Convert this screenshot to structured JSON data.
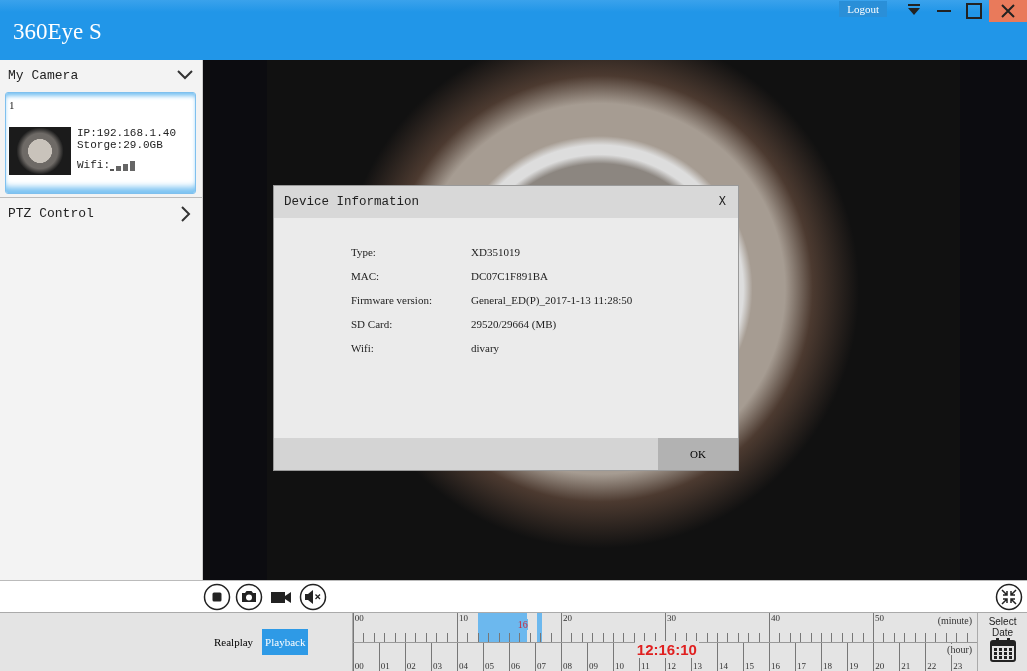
{
  "window": {
    "title": "360Eye S",
    "logout": "Logout"
  },
  "sidebar": {
    "my_camera": {
      "label": "My Camera",
      "expanded": true
    },
    "cameras": [
      {
        "name": "1",
        "ip": "IP:192.168.1.40",
        "storage": "Storge:29.0GB",
        "wifi": "Wifi:",
        "selected": true
      }
    ],
    "ptz": {
      "label": "PTZ Control",
      "expanded": false
    }
  },
  "dialog": {
    "title": "Device Information",
    "close": "X",
    "fields": [
      {
        "label": "Type:",
        "value": "XD351019"
      },
      {
        "label": "MAC:",
        "value": "DC07C1F891BA"
      },
      {
        "label": "Firmware version:",
        "value": "General_ED(P)_2017-1-13 11:28:50"
      },
      {
        "label": "SD Card:",
        "value": "29520/29664 (MB)"
      },
      {
        "label": "Wifi:",
        "value": "divary"
      }
    ],
    "ok": "OK"
  },
  "timeline": {
    "modes": [
      {
        "label": "Realplay",
        "selected": false
      },
      {
        "label": "Playback",
        "selected": true
      }
    ],
    "minute_labels": [
      "00",
      "10",
      "20",
      "30",
      "40",
      "50"
    ],
    "minute_unit": "(minute)",
    "hour_labels": [
      "00",
      "01",
      "02",
      "03",
      "04",
      "05",
      "06",
      "07",
      "08",
      "09",
      "10",
      "11",
      "12",
      "13",
      "14",
      "15",
      "16",
      "17",
      "18",
      "19",
      "20",
      "21",
      "22",
      "23"
    ],
    "hour_unit": "(hour)",
    "minute_marker": "16",
    "current_time": "12:16:10",
    "select_date": "Select Date"
  }
}
